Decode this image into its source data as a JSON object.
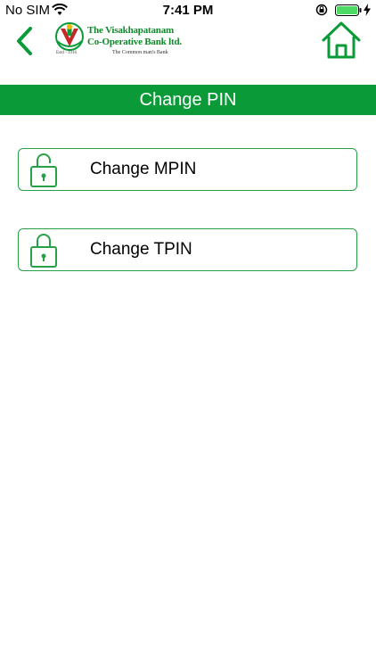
{
  "status_bar": {
    "carrier": "No SIM",
    "time": "7:41 PM"
  },
  "header": {
    "logo": {
      "line1": "The Visakhapatanam",
      "line2": "Co-Operative Bank ltd.",
      "tagline": "The Common man's Bank",
      "estd": "Estd - 1916"
    }
  },
  "page": {
    "title": "Change PIN"
  },
  "options": [
    {
      "label": "Change MPIN",
      "icon": "lock-icon"
    },
    {
      "label": "Change TPIN",
      "icon": "lock-icon"
    }
  ],
  "colors": {
    "brand_green": "#0a9a38",
    "border_green": "#27a046",
    "battery_green": "#4cd964"
  }
}
